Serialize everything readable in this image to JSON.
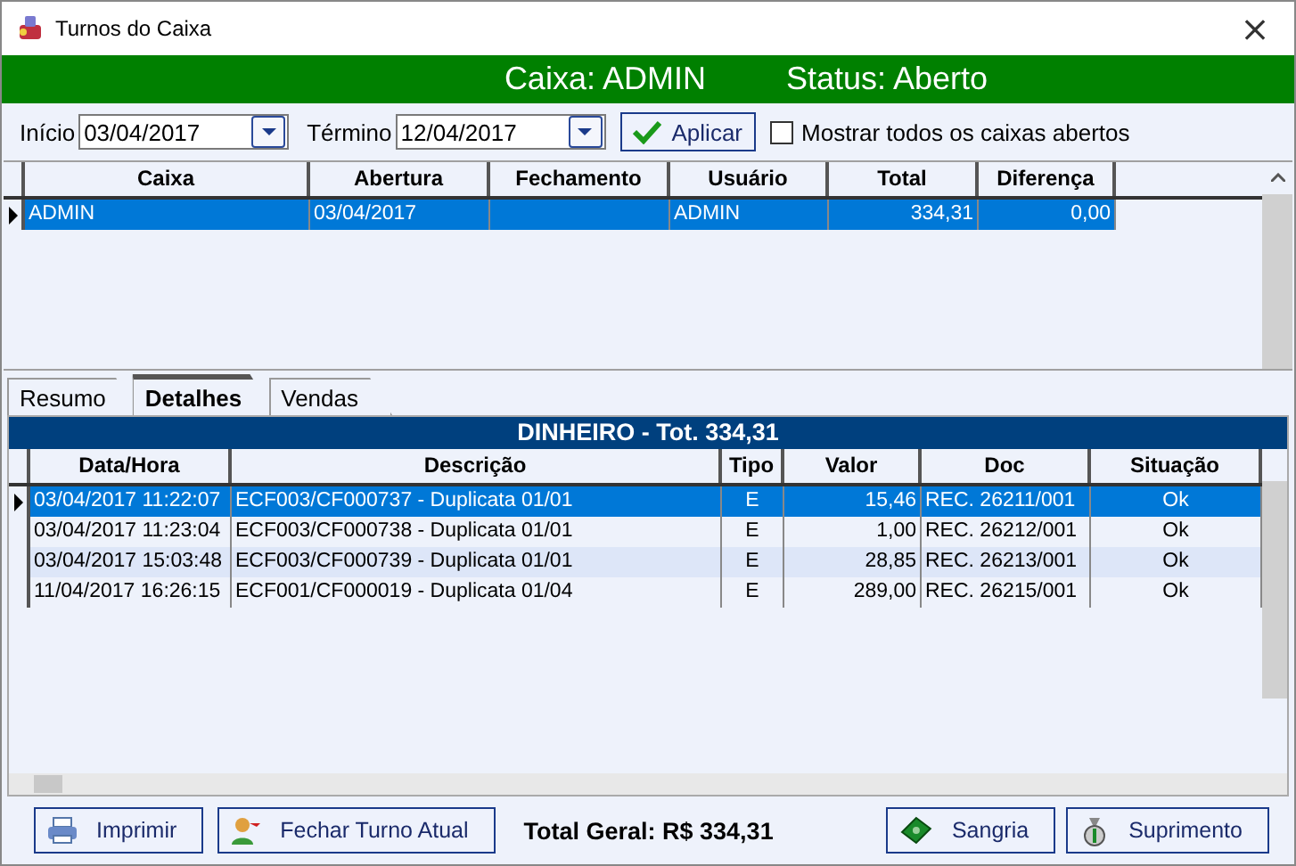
{
  "window": {
    "title": "Turnos do Caixa",
    "close": "×"
  },
  "header": {
    "caixa": "Caixa: ADMIN",
    "status": "Status: Aberto"
  },
  "filter": {
    "start_label": "Início",
    "start_value": "03/04/2017",
    "end_label": "Término",
    "end_value": "12/04/2017",
    "apply": "Aplicar",
    "show_all": {
      "label": "Mostrar todos os caixas abertos",
      "checked": false
    }
  },
  "shifts": {
    "columns": [
      "Caixa",
      "Abertura",
      "Fechamento",
      "Usuário",
      "Total",
      "Diferença"
    ],
    "rows": [
      {
        "cells": [
          "ADMIN",
          "03/04/2017",
          "",
          "ADMIN",
          "334,31",
          "0,00"
        ],
        "selected": true
      }
    ]
  },
  "tabs": [
    {
      "label": "Resumo",
      "selected": false
    },
    {
      "label": "Detalhes",
      "selected": true
    },
    {
      "label": "Vendas",
      "selected": false
    }
  ],
  "details": {
    "band": "DINHEIRO - Tot. 334,31",
    "columns": [
      "Data/Hora",
      "Descrição",
      "Tipo",
      "Valor",
      "Doc",
      "Situação"
    ],
    "rows": [
      {
        "cells": [
          "03/04/2017 11:22:07",
          "ECF003/CF000737 - Duplicata 01/01",
          "E",
          "15,46",
          "REC. 26211/001",
          "Ok"
        ],
        "selected": true
      },
      {
        "cells": [
          "03/04/2017 11:23:04",
          "ECF003/CF000738 - Duplicata 01/01",
          "E",
          "1,00",
          "REC. 26212/001",
          "Ok"
        ],
        "selected": false
      },
      {
        "cells": [
          "03/04/2017 15:03:48",
          "ECF003/CF000739 - Duplicata 01/01",
          "E",
          "28,85",
          "REC. 26213/001",
          "Ok"
        ],
        "selected": false
      },
      {
        "cells": [
          "11/04/2017 16:26:15",
          "ECF001/CF000019 - Duplicata 01/04",
          "E",
          "289,00",
          "REC. 26215/001",
          "Ok"
        ],
        "selected": false
      }
    ]
  },
  "footer": {
    "print": "Imprimir",
    "close_shift": "Fechar Turno Atual",
    "total": "Total Geral: R$ 334,31",
    "withdrawal": "Sangria",
    "supply": "Suprimento"
  }
}
